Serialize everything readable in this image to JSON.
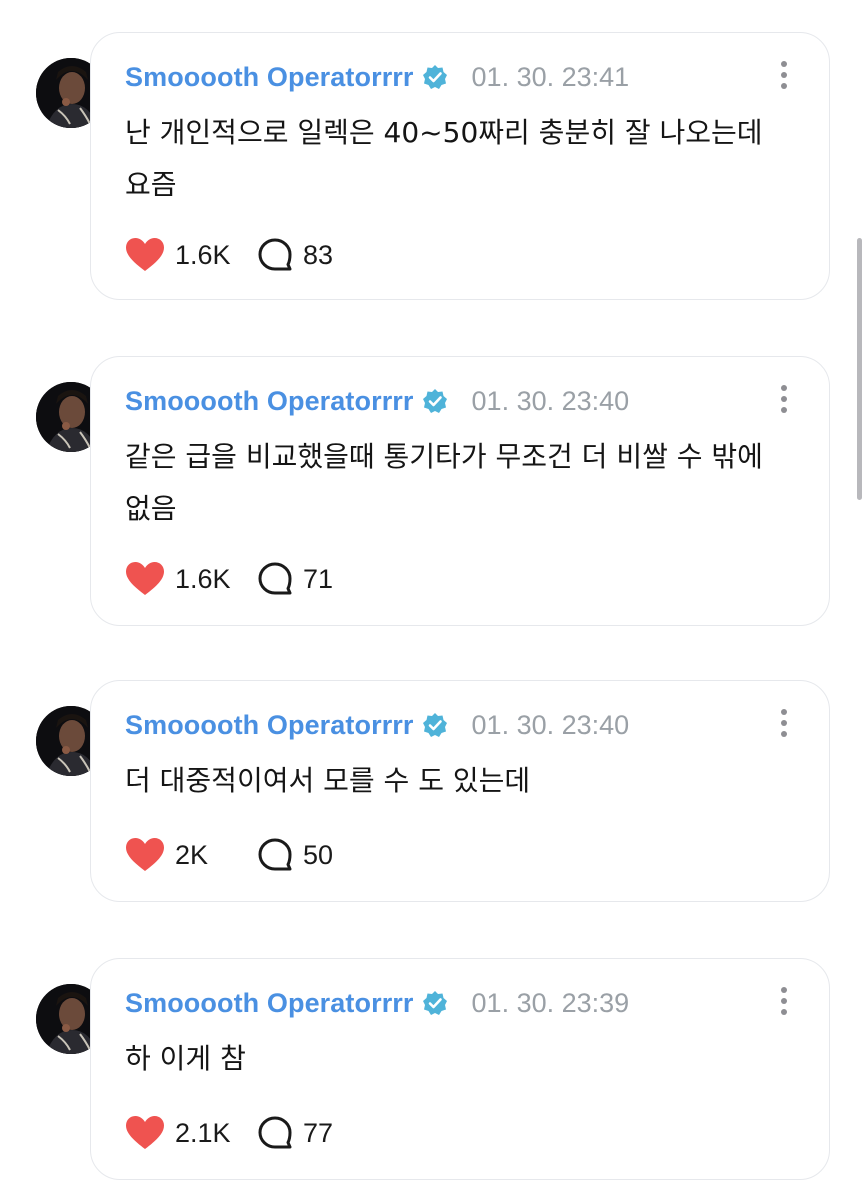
{
  "posts": [
    {
      "author": "Smooooth Operatorrrr",
      "timestamp": "01. 30. 23:41",
      "text": "난 개인적으로 일렉은 40~50짜리 충분히 잘 나오는데 요즘",
      "likes": "1.6K",
      "comments": "83"
    },
    {
      "author": "Smooooth Operatorrrr",
      "timestamp": "01. 30. 23:40",
      "text": "같은 급을 비교했을때 통기타가 무조건 더 비쌀 수 밖에 없음",
      "likes": "1.6K",
      "comments": "71"
    },
    {
      "author": "Smooooth Operatorrrr",
      "timestamp": "01. 30. 23:40",
      "text": "더 대중적이여서 모를 수 도 있는데",
      "likes": "2K",
      "comments": "50"
    },
    {
      "author": "Smooooth Operatorrrr",
      "timestamp": "01. 30. 23:39",
      "text": "하 이게 참",
      "likes": "2.1K",
      "comments": "77"
    }
  ],
  "icons": {
    "verified_badge": "verified-badge-icon",
    "more": "more-vertical-icon",
    "like": "heart-icon",
    "comment": "comment-bubble-icon"
  },
  "colors": {
    "author": "#4a90e2",
    "verified": "#4fb3d9",
    "heart": "#ef5350",
    "timestamp": "#9aa0a6",
    "card_border": "#e6e8ec"
  }
}
